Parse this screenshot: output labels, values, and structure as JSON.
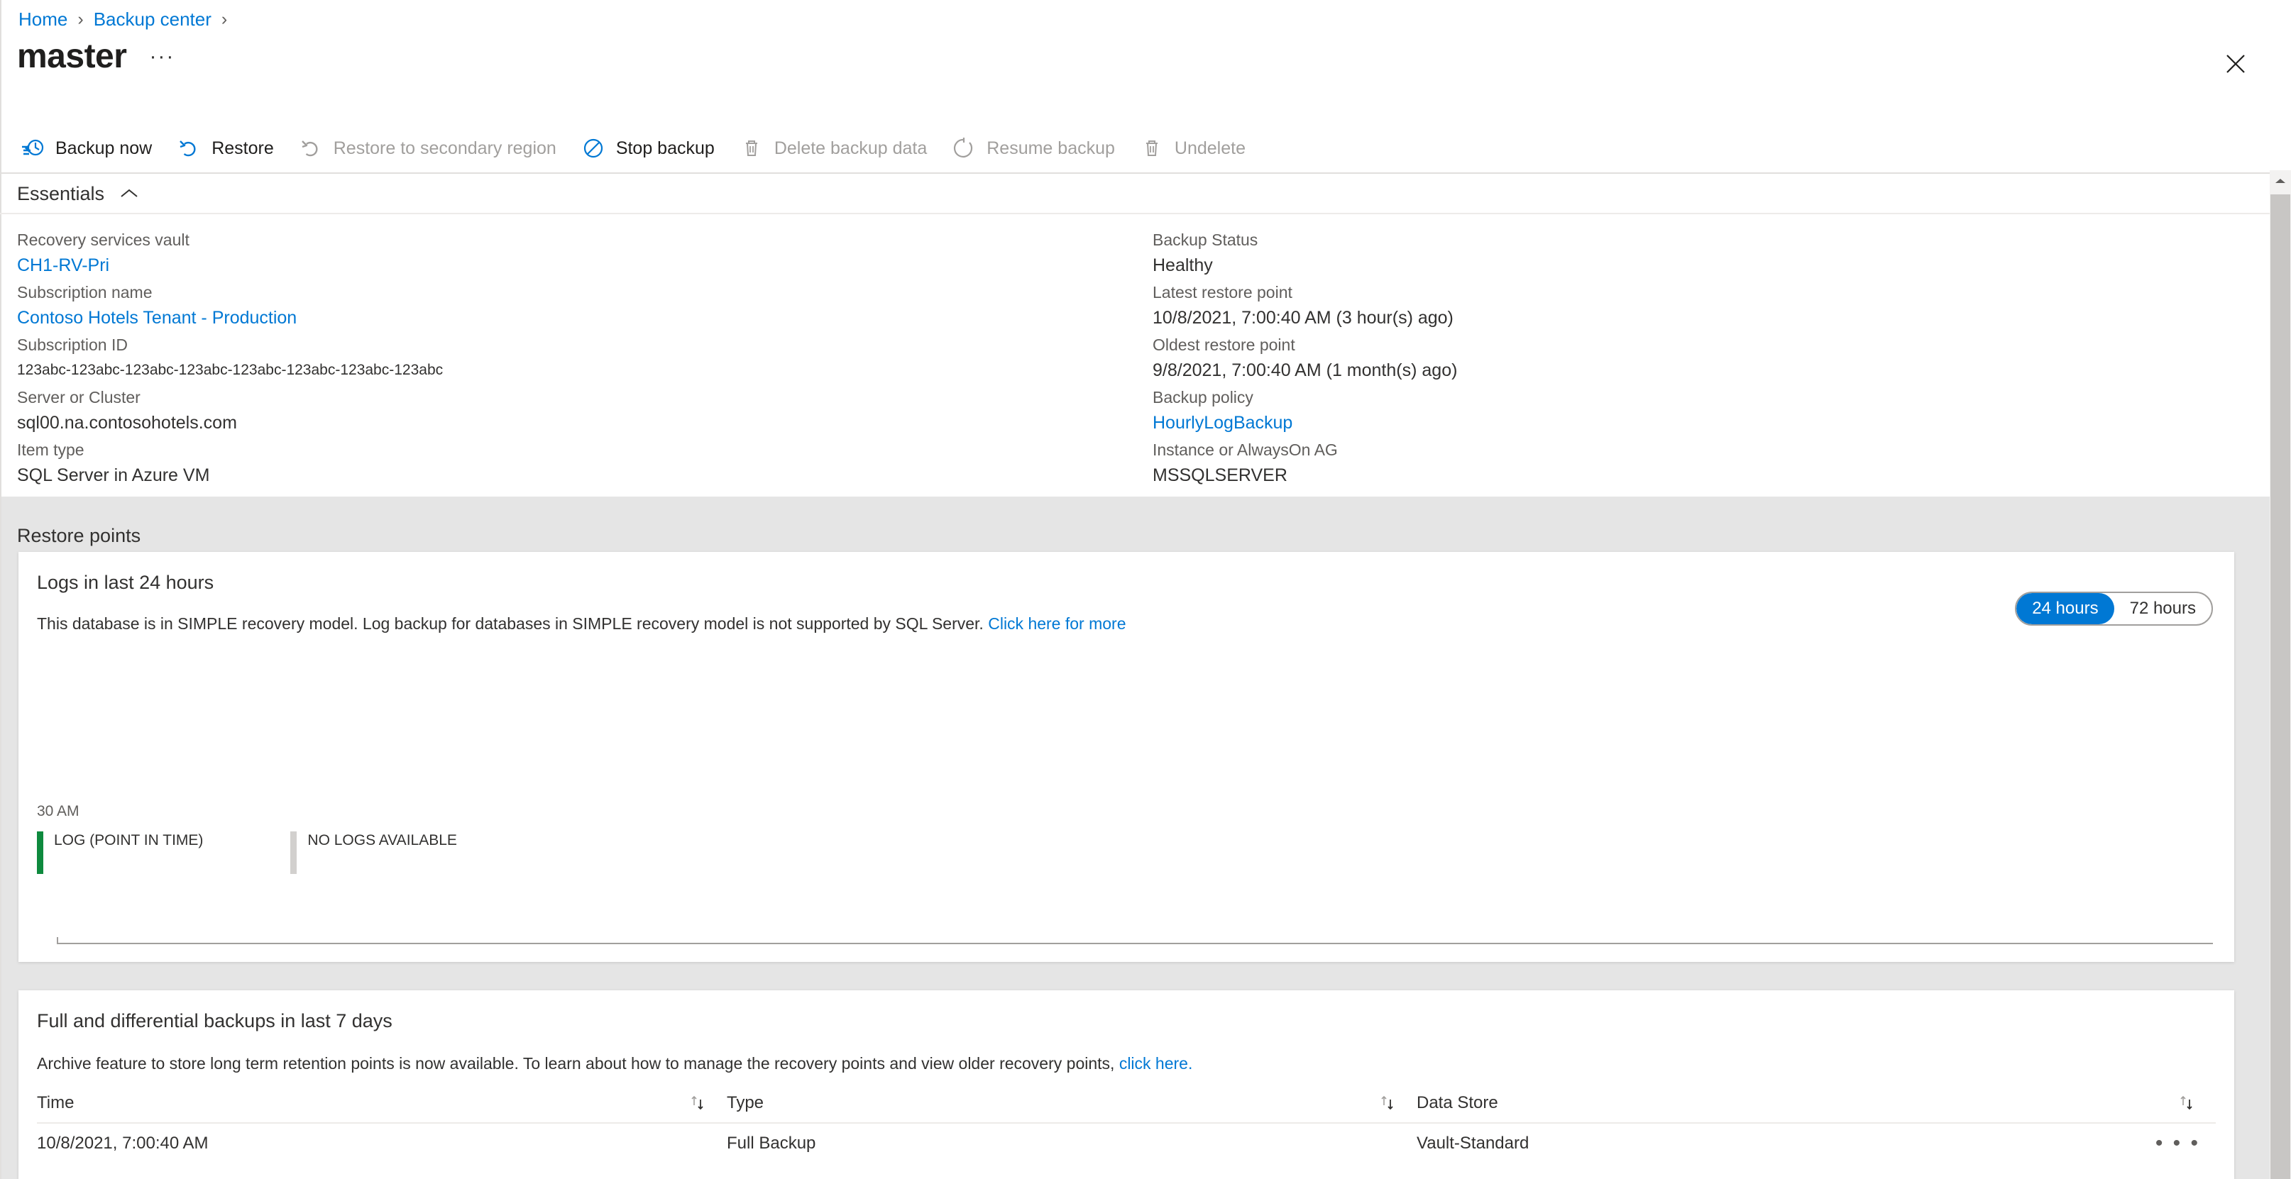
{
  "breadcrumb": {
    "items": [
      {
        "label": "Home",
        "icon": "chevron-right-icon"
      },
      {
        "label": "Backup center",
        "icon": "chevron-right-icon"
      }
    ],
    "separator": "›"
  },
  "header": {
    "title": "master",
    "ellipsis": "···",
    "close_icon": "close-icon"
  },
  "toolbar": {
    "commands": [
      {
        "label": "Backup now",
        "icon": "backup-now-icon",
        "disabled": false
      },
      {
        "label": "Restore",
        "icon": "restore-icon",
        "disabled": false
      },
      {
        "label": "Restore to secondary region",
        "icon": "restore-secondary-icon",
        "disabled": true
      },
      {
        "label": "Stop backup",
        "icon": "stop-backup-icon",
        "disabled": false
      },
      {
        "label": "Delete backup data",
        "icon": "trash-icon",
        "disabled": true
      },
      {
        "label": "Resume backup",
        "icon": "resume-icon",
        "disabled": true
      },
      {
        "label": "Undelete",
        "icon": "trash-icon",
        "disabled": true
      }
    ]
  },
  "essentials": {
    "header_label": "Essentials",
    "chevron_icon": "chevron-up-icon",
    "left": [
      {
        "label": "Recovery services vault",
        "value": "CH1-RV-Pri",
        "link": true,
        "small": false
      },
      {
        "label": "Subscription name",
        "value": "Contoso Hotels Tenant - Production",
        "link": true,
        "small": false
      },
      {
        "label": "Subscription ID",
        "value": "123abc-123abc-123abc-123abc-123abc-123abc-123abc-123abc",
        "link": false,
        "small": true
      },
      {
        "label": "Server or Cluster",
        "value": "sql00.na.contosohotels.com",
        "link": false,
        "small": false
      },
      {
        "label": "Item type",
        "value": "SQL Server in Azure VM",
        "link": false,
        "small": false
      }
    ],
    "right": [
      {
        "label": "Backup Status",
        "value": "Healthy",
        "link": false,
        "small": false
      },
      {
        "label": "Latest restore point",
        "value": "10/8/2021, 7:00:40 AM (3 hour(s) ago)",
        "link": false,
        "small": false
      },
      {
        "label": "Oldest restore point",
        "value": "9/8/2021, 7:00:40 AM (1 month(s) ago)",
        "link": false,
        "small": false
      },
      {
        "label": "Backup policy",
        "value": "HourlyLogBackup",
        "link": true,
        "small": false
      },
      {
        "label": "Instance or AlwaysOn AG",
        "value": "MSSQLSERVER",
        "link": false,
        "small": false
      }
    ]
  },
  "restore_points": {
    "section_heading": "Restore points",
    "logs_card": {
      "title": "Logs in last 24 hours",
      "note_text": "This database is in SIMPLE recovery model. Log backup for databases in SIMPLE recovery model is not supported by SQL Server. ",
      "note_link": "Click here for more",
      "range_toggle": {
        "options": [
          "24 hours",
          "72 hours"
        ],
        "selected": "24 hours"
      },
      "axis_label": "30 AM",
      "legend": [
        {
          "label": "LOG (POINT IN TIME)",
          "color": "#0e8a3e"
        },
        {
          "label": "NO LOGS AVAILABLE",
          "color": "#d2d0ce"
        }
      ]
    },
    "backups_card": {
      "title": "Full and differential backups in last 7 days",
      "note_text": "Archive feature to store long term retention points is now available. To learn about how to manage the recovery points and view older recovery points, ",
      "note_link": "click here.",
      "columns": [
        "Time",
        "Type",
        "Data Store"
      ],
      "sort_icon": "sort-arrows-icon",
      "rows": [
        {
          "time": "10/8/2021, 7:00:40 AM",
          "type": "Full Backup",
          "store": "Vault-Standard",
          "menu": "• • •"
        }
      ]
    }
  },
  "scrollbar": {
    "up_icon": "scroll-up-icon"
  },
  "chart_data": {
    "type": "bar",
    "title": "Logs in last 24 hours",
    "categories": [
      "30 AM"
    ],
    "values": [
      0
    ],
    "series": [
      {
        "name": "LOG (POINT IN TIME)",
        "values": [
          0
        ],
        "color": "#0e8a3e"
      },
      {
        "name": "NO LOGS AVAILABLE",
        "values": [
          0
        ],
        "color": "#d2d0ce"
      }
    ],
    "xlabel": "",
    "ylabel": "",
    "xticklabels": [
      "30 AM"
    ],
    "grid": false,
    "legend_position": "bottom",
    "note": "No log restore points plotted; database is in SIMPLE recovery model."
  },
  "colors": {
    "accent": "#0078d4",
    "link": "#0078d4",
    "log_green": "#0e8a3e",
    "no_logs_grey": "#d2d0ce",
    "page_grey": "#e5e5e5",
    "divider": "#e1dfdd"
  }
}
